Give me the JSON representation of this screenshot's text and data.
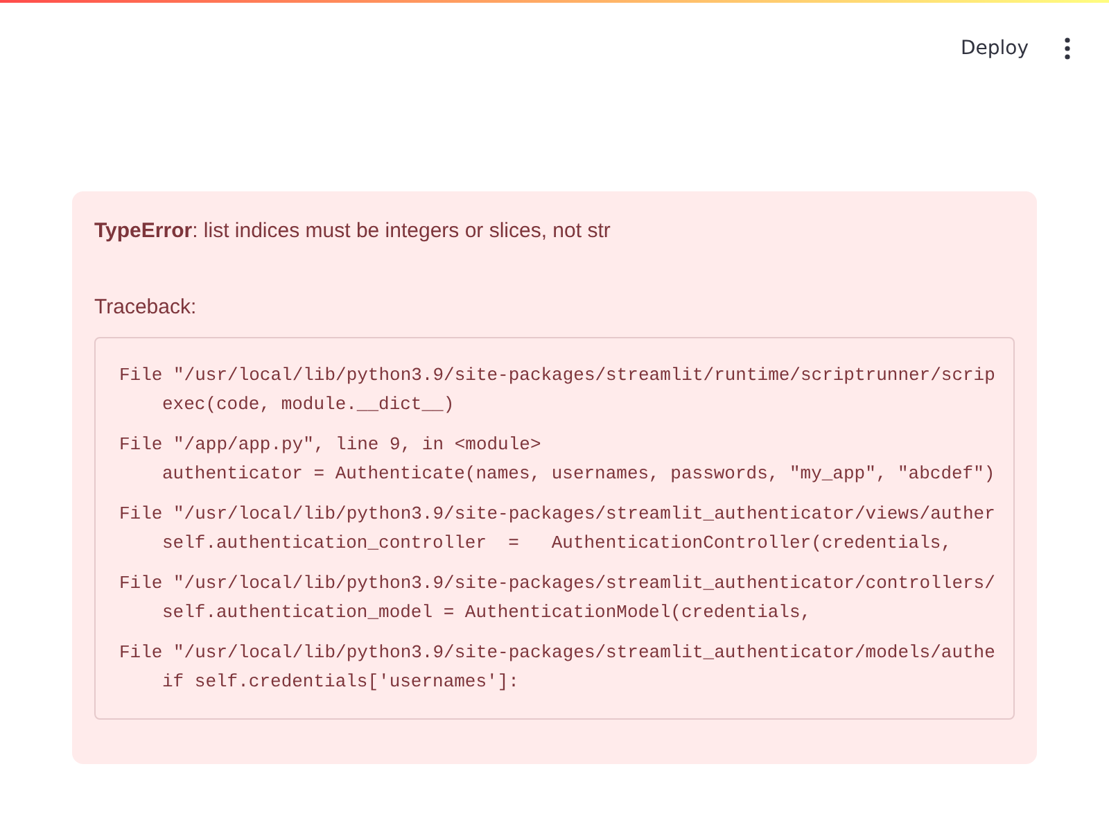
{
  "header": {
    "deploy": "Deploy"
  },
  "error": {
    "message": "**TypeError**: list indices must be integers or slices, not str",
    "traceback_label": "Traceback:",
    "frames": [
      {
        "file": "File \"/usr/local/lib/python3.9/site-packages/streamlit/runtime/scriptrunner/scrip",
        "code": "exec(code, module.__dict__)"
      },
      {
        "file": "File \"/app/app.py\", line 9, in <module>",
        "code": "authenticator = Authenticate(names, usernames, passwords, \"my_app\", \"abcdef\")"
      },
      {
        "file": "File \"/usr/local/lib/python3.9/site-packages/streamlit_authenticator/views/auther",
        "code": "self.authentication_controller  =   AuthenticationController(credentials,"
      },
      {
        "file": "File \"/usr/local/lib/python3.9/site-packages/streamlit_authenticator/controllers/",
        "code": "self.authentication_model = AuthenticationModel(credentials,"
      },
      {
        "file": "File \"/usr/local/lib/python3.9/site-packages/streamlit_authenticator/models/authe",
        "code": "if self.credentials['usernames']:"
      }
    ]
  }
}
